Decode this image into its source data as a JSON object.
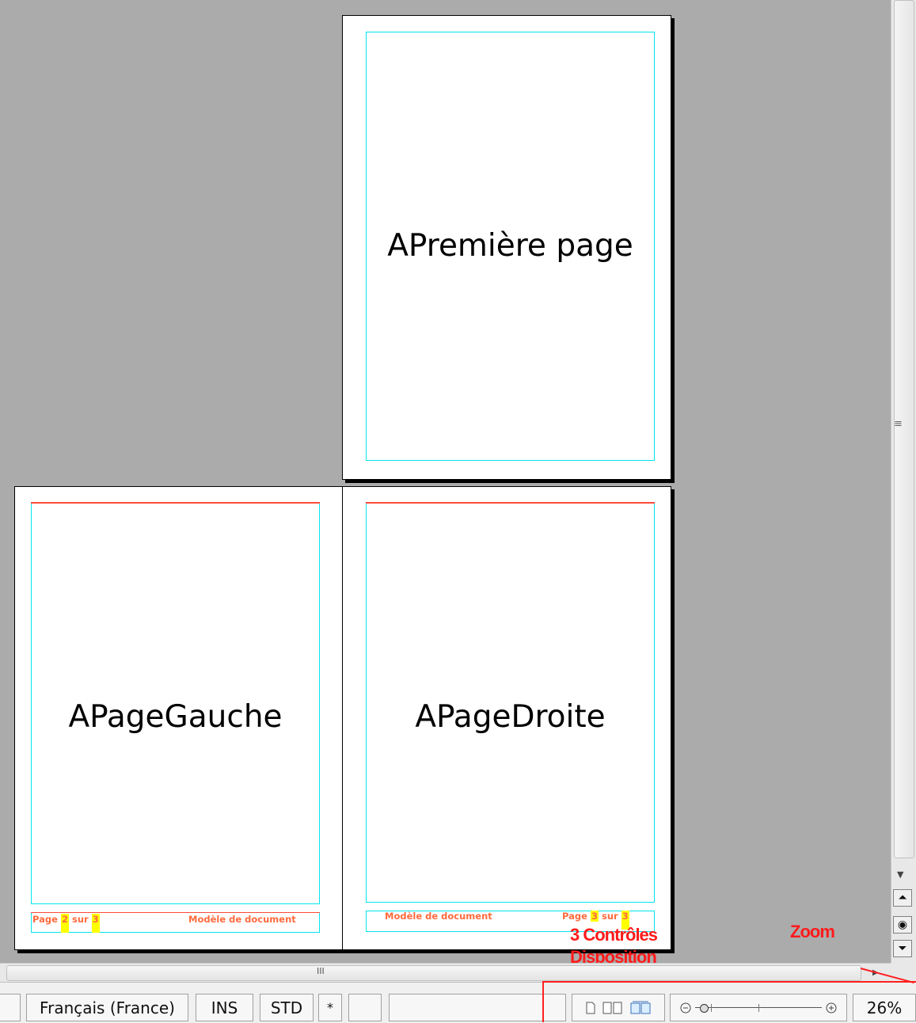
{
  "document": {
    "pages": [
      {
        "name": "first",
        "text": "APremière page"
      },
      {
        "name": "left",
        "text": "APageGauche",
        "footer": {
          "page_word": "Page",
          "page_num": "2",
          "of_word": "sur",
          "total": "3",
          "doc": "Modèle de document"
        }
      },
      {
        "name": "right",
        "text": "APageDroite",
        "footer": {
          "page_word": "Page",
          "page_num": "3",
          "of_word": "sur",
          "total": "3",
          "doc": "Modèle de document"
        }
      }
    ]
  },
  "annotations": {
    "layout_label": "3 Contrôles\nDisposition",
    "zoom_label": "Zoom"
  },
  "statusbar": {
    "language": "Français (France)",
    "insert_mode": "INS",
    "selection_mode": "STD",
    "modified": "*",
    "zoom_percent": "26%"
  },
  "colors": {
    "margin_guide": "#00e5ee",
    "header_footer_line": "#ff4b3a",
    "annotation": "#ff1a1a",
    "field_highlight": "#ffff00"
  },
  "icons": [
    "single-page-view-icon",
    "multi-page-view-icon",
    "book-view-icon",
    "zoom-out-icon",
    "zoom-in-icon",
    "scroll-up-icon",
    "navigator-icon",
    "scroll-down-icon"
  ]
}
